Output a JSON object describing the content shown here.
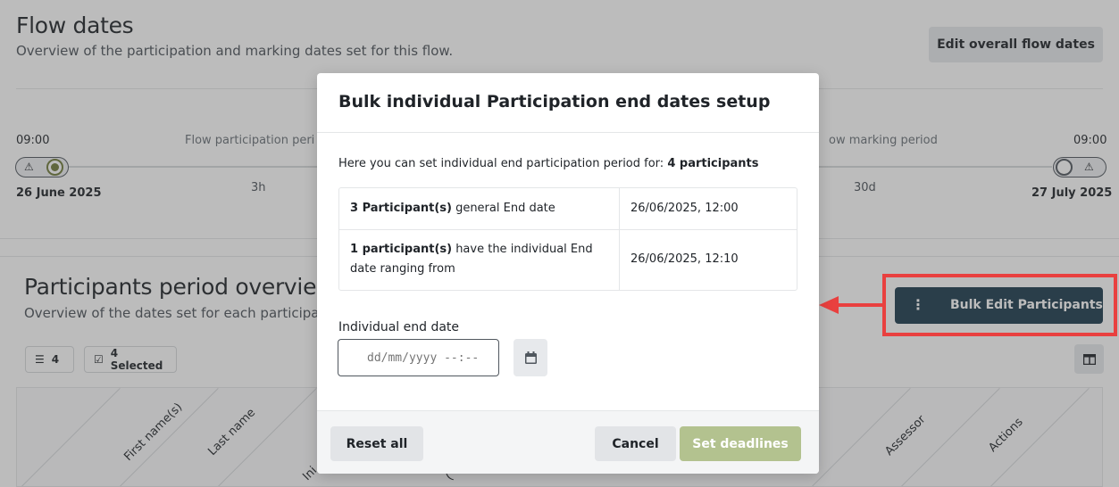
{
  "flow": {
    "title": "Flow dates",
    "subtitle": "Overview of the participation and marking dates set for this flow.",
    "edit_button": "Edit overall flow dates",
    "timeline": {
      "start_time": "09:00",
      "start_date": "26 June 2025",
      "participation_label": "Flow participation peri",
      "participation_duration": "3h",
      "marking_label": "ow marking period",
      "marking_duration": "30d",
      "end_time": "09:00",
      "end_date": "27 July 2025",
      "warn_glyph": "⚠"
    }
  },
  "participants": {
    "title": "Participants period overview",
    "subtitle": "Overview of the dates set for each participan",
    "count_chip": "4",
    "selected_chip": "4 Selected",
    "bulk_button": "Bulk Edit Participants",
    "columns": [
      "First name(s)",
      "Last name",
      "Ini",
      "(",
      "Assessor",
      "Actions"
    ]
  },
  "modal": {
    "title": "Bulk individual Participation end dates setup",
    "intro_prefix": "Here you can set individual end participation period for: ",
    "intro_bold": "4 participants",
    "rows": [
      {
        "bold": "3 Participant(s)",
        "text": " general End date",
        "value": "26/06/2025, 12:00"
      },
      {
        "bold": "1 participant(s)",
        "text": " have the individual End",
        "text2": "date ranging from",
        "value": "26/06/2025, 12:10"
      }
    ],
    "field_label": "Individual end date",
    "date_placeholder": "dd/mm/yyyy --:--",
    "reset_button": "Reset all",
    "cancel_button": "Cancel",
    "set_button": "Set deadlines"
  },
  "colors": {
    "primary_dark": "#1c3a4d",
    "set_deadlines_disabled": "#b3c28f",
    "annotation_red": "#e9403f",
    "active_dot": "#6f7a3a"
  }
}
